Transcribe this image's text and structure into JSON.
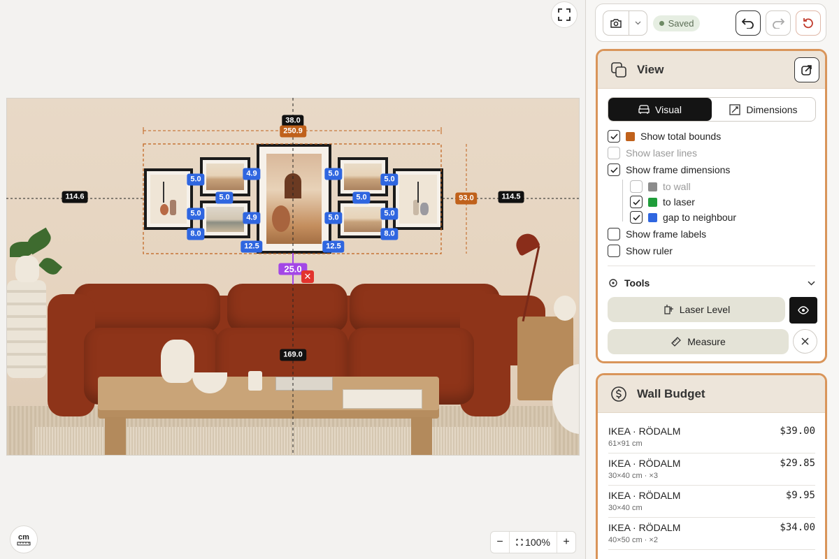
{
  "canvas": {
    "zoom_minus": "−",
    "zoom_value": "100%",
    "zoom_plus": "+",
    "unit_label": "cm"
  },
  "measurements": {
    "left_wall": "114.6",
    "right_wall": "114.5",
    "top_gap": "38.0",
    "bounds_width": "250.9",
    "bounds_height": "93.0",
    "laser_height": "25.0",
    "floor_distance": "169.0",
    "gap_labels": [
      "5.0",
      "4.9",
      "5.0",
      "5.0",
      "5.0",
      "5.0",
      "4.9",
      "5.0",
      "5.0",
      "5.0",
      "8.0",
      "8.0",
      "12.5",
      "12.5"
    ]
  },
  "toolbar": {
    "saved_label": "Saved"
  },
  "view": {
    "title": "View",
    "tab_visual": "Visual",
    "tab_dimensions": "Dimensions",
    "options": {
      "total_bounds": "Show total bounds",
      "laser_lines": "Show laser lines",
      "frame_dimensions": "Show frame dimensions",
      "to_wall": "to wall",
      "to_laser": "to laser",
      "gap_neighbour": "gap to neighbour",
      "frame_labels": "Show frame labels",
      "ruler": "Show ruler"
    },
    "tools_title": "Tools",
    "laser_level": "Laser Level",
    "measure": "Measure"
  },
  "colors": {
    "bounds": "#c0611b",
    "to_wall": "#8c8c8c",
    "to_laser": "#1f9d3a",
    "gap_neighbour": "#2f66e0",
    "accent_border": "#d9955a"
  },
  "budget": {
    "title": "Wall Budget",
    "items": [
      {
        "name": "IKEA · RÖDALM",
        "detail": "61×91 cm",
        "price": "$39.00"
      },
      {
        "name": "IKEA · RÖDALM",
        "detail": "30×40 cm · ×3",
        "price": "$29.85"
      },
      {
        "name": "IKEA · RÖDALM",
        "detail": "30×40 cm",
        "price": "$9.95"
      },
      {
        "name": "IKEA · RÖDALM",
        "detail": "40×50 cm · ×2",
        "price": "$34.00"
      }
    ]
  }
}
